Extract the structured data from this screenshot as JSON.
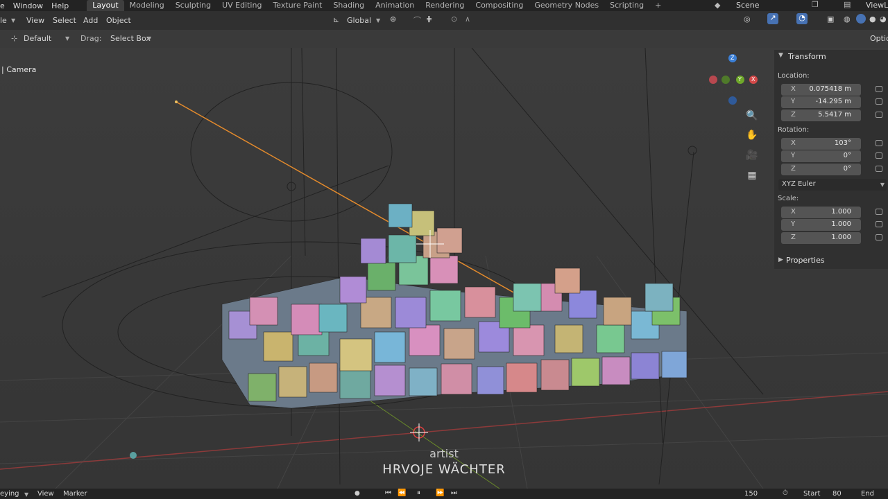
{
  "menus": [
    "e",
    "Window",
    "Help"
  ],
  "workspaces": [
    "Layout",
    "Modeling",
    "Sculpting",
    "UV Editing",
    "Texture Paint",
    "Shading",
    "Animation",
    "Rendering",
    "Compositing",
    "Geometry Nodes",
    "Scripting",
    "+"
  ],
  "scene_label": "Scene",
  "viewlayer_label": "ViewL",
  "toolbar": {
    "editor_stub": "le",
    "menu": [
      "View",
      "Select",
      "Add",
      "Object"
    ],
    "orientation": "Global"
  },
  "header2": {
    "orientation_default": "Default",
    "drag_label": "Drag:",
    "drag_value": "Select Box",
    "options": "Optio"
  },
  "viewport": {
    "object_name": "| Camera",
    "credit_top": "artist",
    "credit_name": "HRVOJE WÄCHTER"
  },
  "npanel": {
    "transform_title": "Transform",
    "location_label": "Location:",
    "location": [
      {
        "axis": "X",
        "value": "0.075418 m"
      },
      {
        "axis": "Y",
        "value": "-14.295 m"
      },
      {
        "axis": "Z",
        "value": "5.5417 m"
      }
    ],
    "rotation_label": "Rotation:",
    "rotation": [
      {
        "axis": "X",
        "value": "103°"
      },
      {
        "axis": "Y",
        "value": "0°"
      },
      {
        "axis": "Z",
        "value": "0°"
      }
    ],
    "rotation_mode": "XYZ Euler",
    "scale_label": "Scale:",
    "scale": [
      {
        "axis": "X",
        "value": "1.000"
      },
      {
        "axis": "Y",
        "value": "1.000"
      },
      {
        "axis": "Z",
        "value": "1.000"
      }
    ],
    "properties_title": "Properties"
  },
  "gizmo": {
    "x": "X",
    "y": "Y",
    "z": "Z"
  },
  "timeline": {
    "keying": "eying",
    "view": "View",
    "marker": "Marker",
    "current_frame": "150",
    "start_label": "Start",
    "start_value": "80",
    "end_label": "End"
  }
}
